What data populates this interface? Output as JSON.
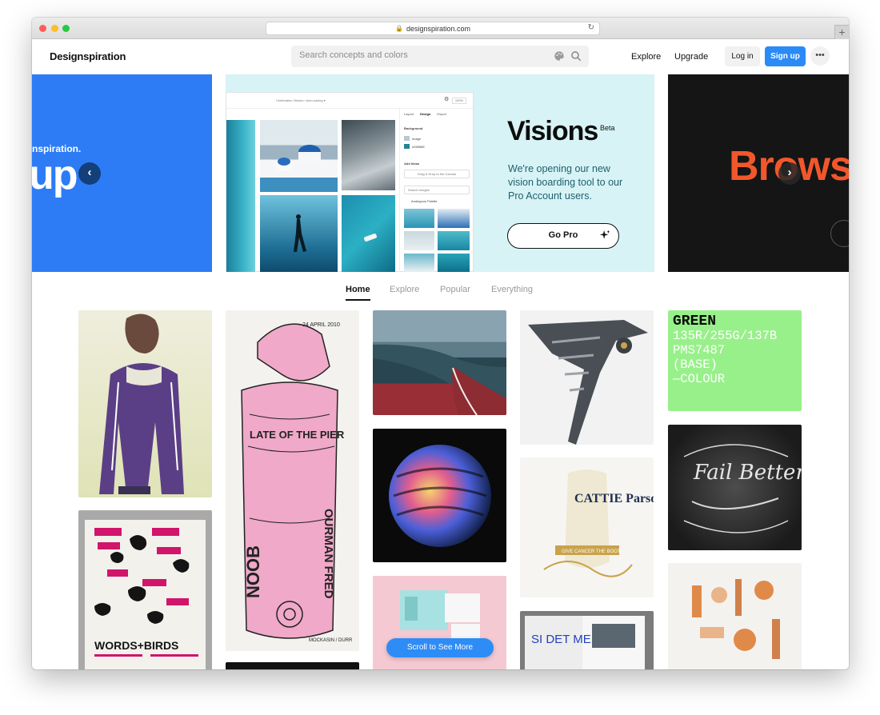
{
  "browser": {
    "url": "designspiration.com"
  },
  "nav": {
    "logo": "Designspiration",
    "search_placeholder": "Search concepts and colors",
    "explore": "Explore",
    "upgrade": "Upgrade",
    "login": "Log in",
    "signup": "Sign up",
    "more": "•••"
  },
  "hero": {
    "left_small": "nspiration.",
    "left_big": "up",
    "prev_arrow": "‹",
    "center": {
      "title": "Visions",
      "badge": "Beta",
      "description": "We're opening our new vision boarding tool to our Pro Account users.",
      "cta": "Go Pro",
      "mock": {
        "crumb": "Celebration Visions  /  Auto-saving ▾",
        "zoom": "100%",
        "tabs": [
          "Layout",
          "Design",
          "Export"
        ],
        "background_label": "Background",
        "image_label": "Image",
        "color_hex": "#26858E",
        "add_ideas_label": "Add Ideas",
        "drop_label": "Drag & Drop to the Canvas",
        "search_label": "Search Images",
        "palette_label": "Analogous Palette"
      }
    },
    "right_text": "Brows",
    "next_arrow": "›"
  },
  "tabs": [
    "Home",
    "Explore",
    "Popular",
    "Everything"
  ],
  "scroll_button": "Scroll to See More",
  "colors": {
    "accent": "#2a8af6",
    "hero_left": "#2d7cf6",
    "hero_center": "#d7f3f6",
    "hero_right": "#151515",
    "browse_orange": "#f2572c"
  },
  "cards": {
    "green_card": {
      "line1": "GREEN",
      "line2": "135R/255G/137B",
      "line3": "PMS7487",
      "line4": "(BASE)",
      "line5": "—COLOUR"
    },
    "poster_text": {
      "title": "LATE OF THE PIER",
      "date": "24 APRIL 2010",
      "name1": "NOOB",
      "name2": "OURMAN FRED",
      "name3": "MOCKASIN / DURR"
    },
    "birds_title": "WORDS+BIRDS",
    "fail_better": "Fail Better",
    "cattie_text": "CATTIE Parsons BALL",
    "cattie_ribbon": "GIVE CANCER THE BOOT",
    "magazine_text": "SI DET MED"
  }
}
